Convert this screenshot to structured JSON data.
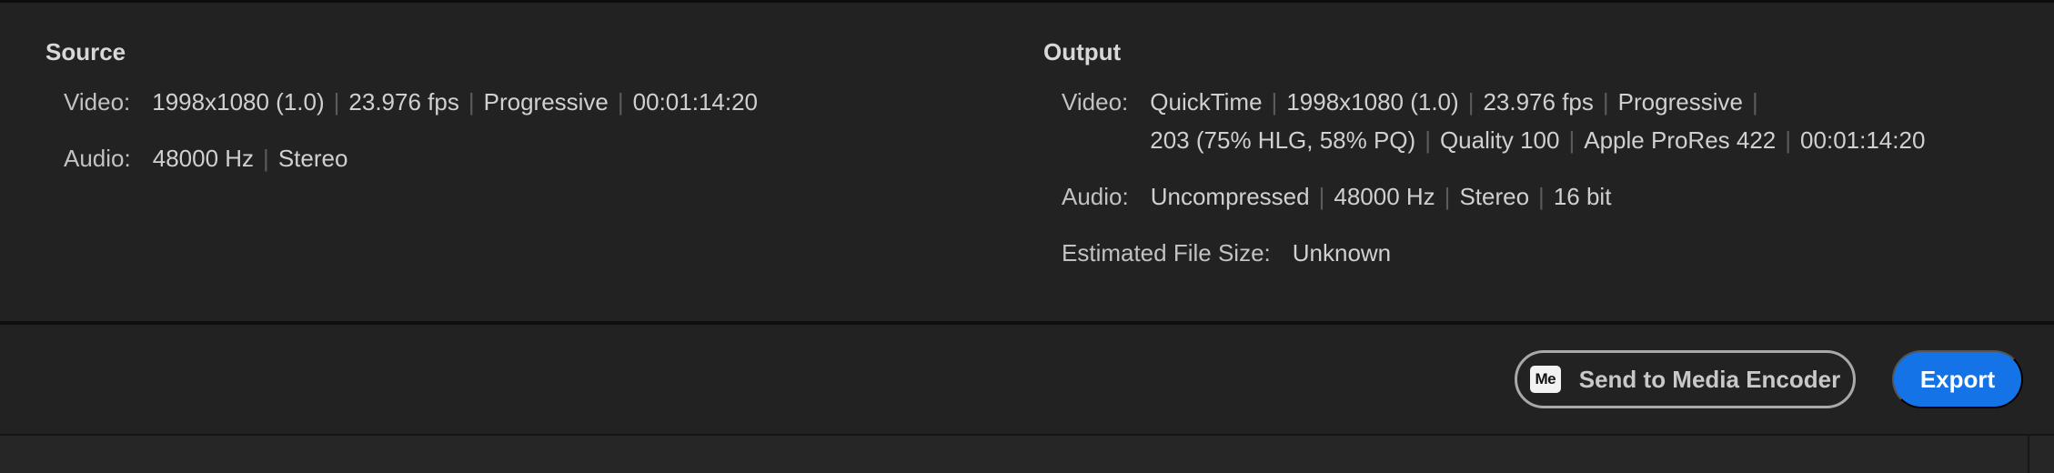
{
  "source": {
    "title": "Source",
    "video_label": "Video:",
    "video": [
      "1998x1080 (1.0)",
      "23.976 fps",
      "Progressive",
      "00:01:14:20"
    ],
    "audio_label": "Audio:",
    "audio": [
      "48000 Hz",
      "Stereo"
    ]
  },
  "output": {
    "title": "Output",
    "video_label": "Video:",
    "video": [
      "QuickTime",
      "1998x1080 (1.0)",
      "23.976 fps",
      "Progressive",
      "203 (75% HLG, 58% PQ)",
      "Quality 100",
      "Apple ProRes 422",
      "00:01:14:20"
    ],
    "audio_label": "Audio:",
    "audio": [
      "Uncompressed",
      "48000 Hz",
      "Stereo",
      "16 bit"
    ],
    "file_size_label": "Estimated File Size:",
    "file_size": "Unknown"
  },
  "actions": {
    "encoder_icon": "Me",
    "encoder_label": "Send to Media Encoder",
    "export_label": "Export"
  },
  "colors": {
    "accent": "#1473e6",
    "background": "#222222"
  }
}
